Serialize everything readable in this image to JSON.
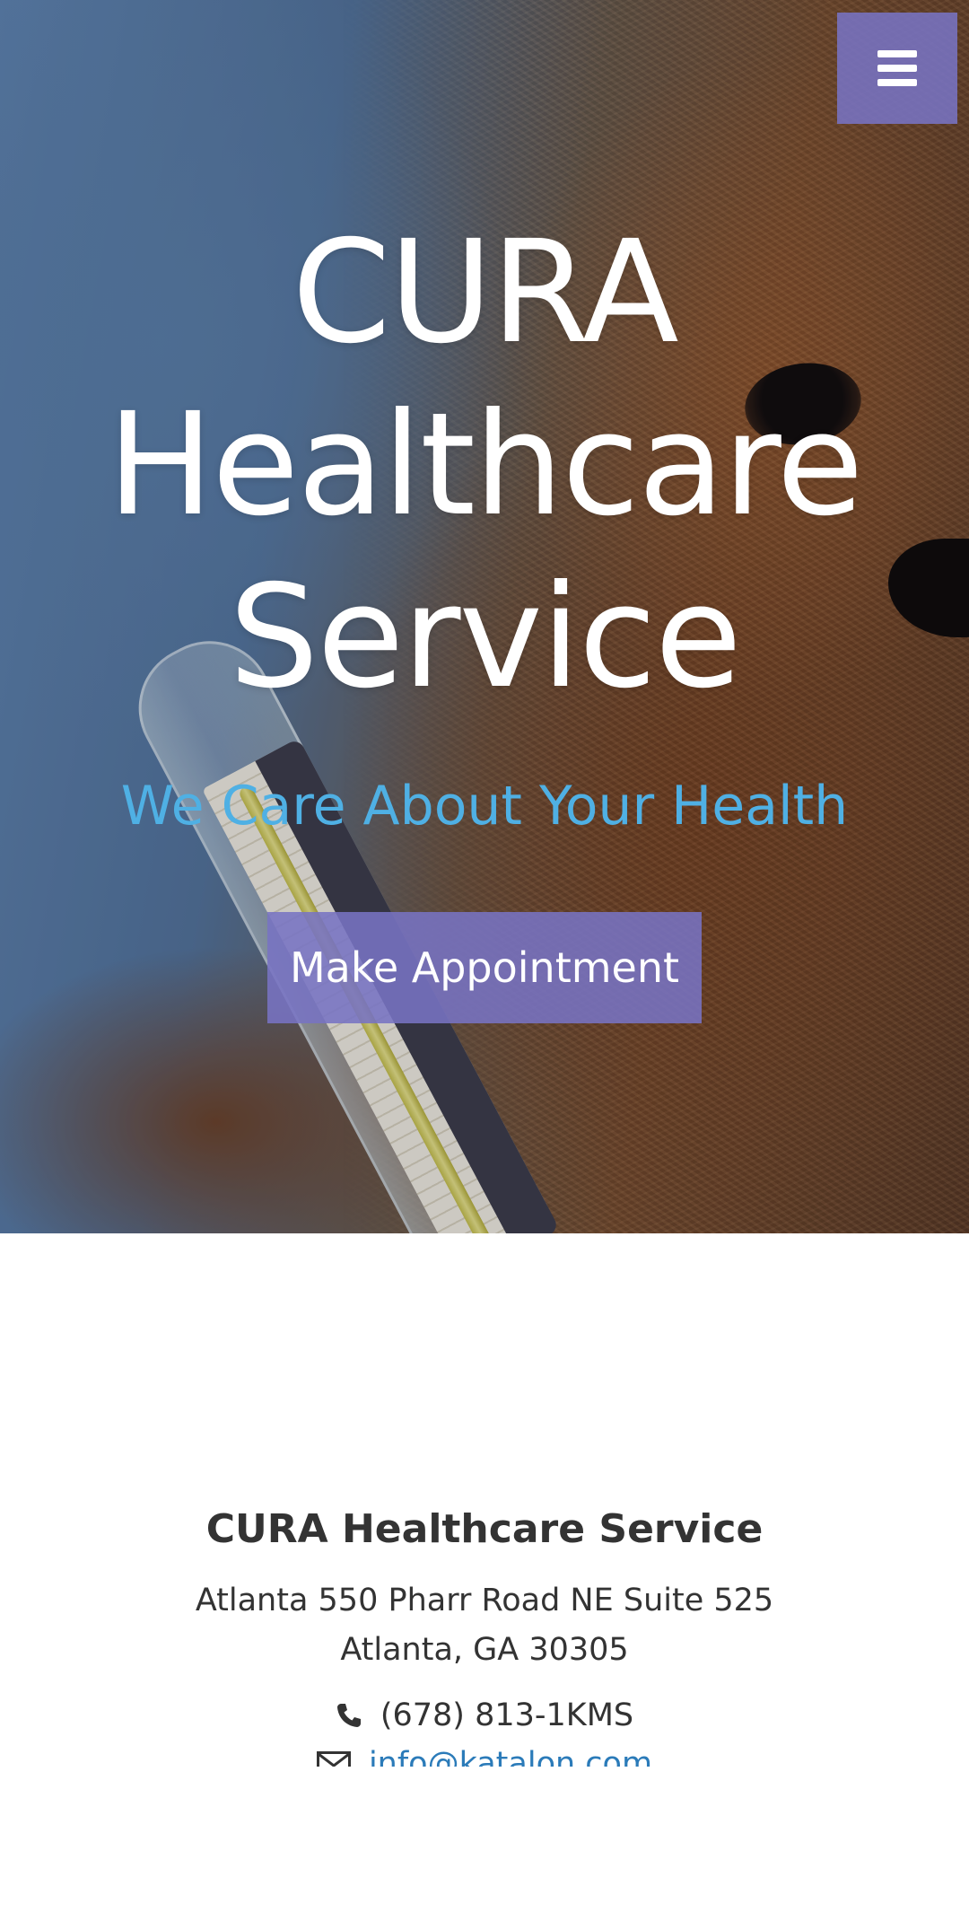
{
  "header": {
    "menu_icon": "bars-icon",
    "accent_color": "#7873c3"
  },
  "hero": {
    "title_line1": "CURA",
    "title_line2": "Healthcare",
    "title_line3": "Service",
    "tagline": "We Care About Your Health",
    "tagline_color": "#4fb0e4",
    "appointment_button": "Make Appointment"
  },
  "contact": {
    "name": "CURA Healthcare Service",
    "address_line1": "Atlanta 550 Pharr Road NE Suite 525",
    "address_line2": "Atlanta, GA 30305",
    "phone_icon": "phone-icon",
    "phone": "(678) 813-1KMS",
    "email_icon": "envelope-icon",
    "email": "info@katalon.com",
    "link_color": "#2b7bb9"
  }
}
